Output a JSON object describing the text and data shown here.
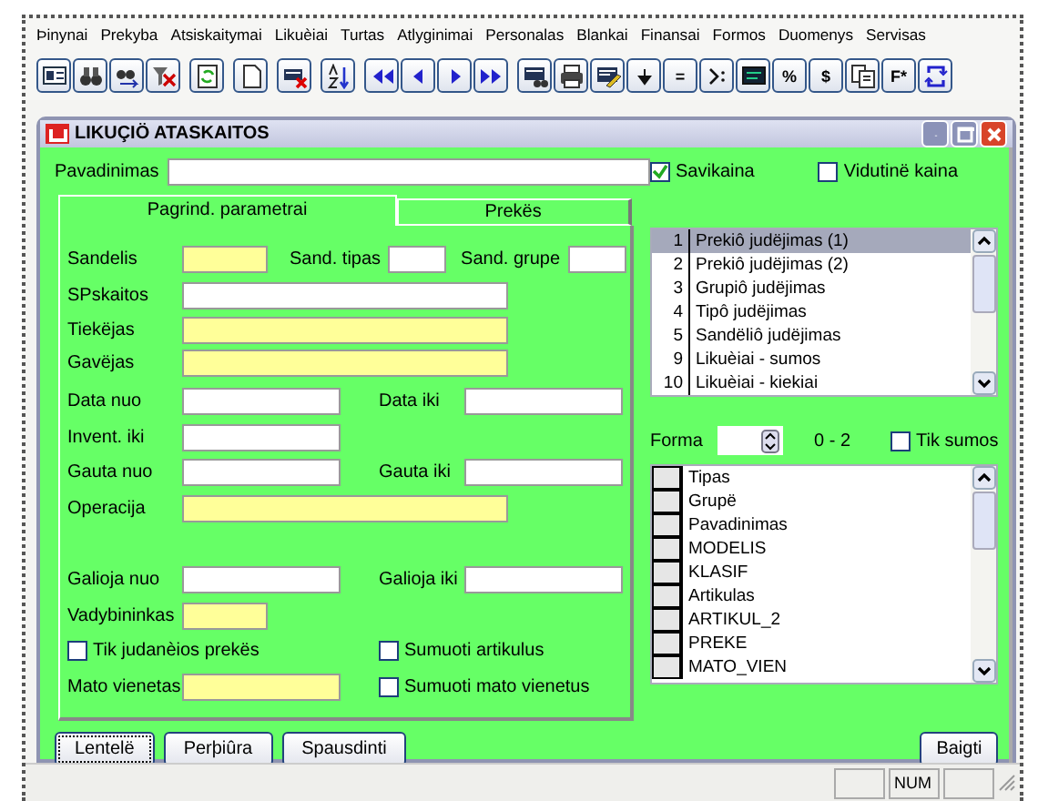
{
  "menu": [
    "Þinynai",
    "Prekyba",
    "Atsiskaitymai",
    "Likuèiai",
    "Turtas",
    "Atlyginimai",
    "Personalas",
    "Blankai",
    "Finansai",
    "Formos",
    "Duomenys",
    "Servisas"
  ],
  "toolbar": [
    [
      {
        "kind": "icon"
      },
      {
        "kind": "icon"
      },
      {
        "kind": "icon"
      },
      {
        "kind": "icon"
      }
    ],
    [
      {
        "kind": "icon"
      }
    ],
    [
      {
        "kind": "icon"
      }
    ],
    [
      {
        "kind": "icon"
      }
    ],
    [
      {
        "kind": "icon"
      }
    ],
    [
      {
        "kind": "icon"
      },
      {
        "kind": "icon"
      },
      {
        "kind": "icon"
      },
      {
        "kind": "icon"
      }
    ],
    [
      {
        "kind": "icon"
      },
      {
        "kind": "icon"
      },
      {
        "kind": "icon"
      },
      {
        "kind": "icon"
      },
      {
        "kind": "text",
        "label": "="
      },
      {
        "kind": "icon"
      },
      {
        "kind": "icon"
      },
      {
        "kind": "text",
        "label": "%"
      },
      {
        "kind": "text",
        "label": "$"
      },
      {
        "kind": "icon"
      },
      {
        "kind": "text",
        "label": "F*"
      },
      {
        "kind": "icon"
      }
    ]
  ],
  "window": {
    "title": "LIKUÇIÖ ATASKAITOS"
  },
  "name_field": {
    "label": "Pavadinimas"
  },
  "tabs": [
    {
      "label": "Pagrind. parametrai",
      "selected": true
    },
    {
      "label": "Prekës",
      "selected": false
    }
  ],
  "rows": [
    {
      "left": [
        {
          "kind": "label",
          "text": "Sandelis"
        },
        {
          "kind": "field-short",
          "highlighted": true
        },
        {
          "kind": "label",
          "text": "Sand. tipas"
        },
        {
          "kind": "field-tiny",
          "highlighted": false
        },
        {
          "kind": "label",
          "text": "Sand. grupe"
        },
        {
          "kind": "field-tiny",
          "highlighted": false
        }
      ]
    },
    {
      "left": [
        {
          "kind": "label",
          "text": "SPskaitos"
        },
        {
          "kind": "field-wide",
          "highlighted": false
        }
      ]
    },
    {
      "left": [
        {
          "kind": "label",
          "text": "Tiekëjas"
        },
        {
          "kind": "field-wide",
          "highlighted": true
        }
      ]
    },
    {
      "left": [
        {
          "kind": "label",
          "text": "Gavëjas"
        },
        {
          "kind": "field-wide",
          "highlighted": true
        }
      ]
    },
    {
      "left": [
        {
          "kind": "label",
          "text": "Data nuo"
        },
        {
          "kind": "field-medium",
          "highlighted": false
        }
      ],
      "right": [
        {
          "kind": "label",
          "text": "Data iki"
        },
        {
          "kind": "field-medium",
          "highlighted": false
        }
      ]
    },
    {
      "left": [
        {
          "kind": "label",
          "text": "Invent. iki"
        },
        {
          "kind": "field-medium",
          "highlighted": false
        }
      ]
    },
    {
      "left": [
        {
          "kind": "label",
          "text": "Gauta nuo"
        },
        {
          "kind": "field-medium",
          "highlighted": false
        }
      ],
      "right": [
        {
          "kind": "label",
          "text": "Gauta iki"
        },
        {
          "kind": "field-medium",
          "highlighted": false
        }
      ]
    },
    {
      "left": [
        {
          "kind": "label",
          "text": "Operacija"
        },
        {
          "kind": "field-long",
          "highlighted": true
        }
      ]
    },
    {
      "left": [
        {
          "kind": "label",
          "text": "Galioja nuo"
        },
        {
          "kind": "field-medium",
          "highlighted": false
        }
      ],
      "right": [
        {
          "kind": "label",
          "text": "Galioja iki"
        },
        {
          "kind": "field-medium",
          "highlighted": false
        }
      ]
    },
    {
      "left": [
        {
          "kind": "label",
          "text": "Vadybininkas"
        },
        {
          "kind": "field-short",
          "highlighted": true
        }
      ]
    },
    {
      "left": [
        {
          "kind": "checkbox",
          "label": "Tik judanèios prekës",
          "checked": false
        }
      ],
      "right": [
        {
          "kind": "checkbox",
          "label": "Sumuoti artikulus",
          "checked": false
        }
      ]
    },
    {
      "left": [
        {
          "kind": "label",
          "text": "Mato vienetas"
        },
        {
          "kind": "field-medium",
          "highlighted": true
        }
      ],
      "right": [
        {
          "kind": "checkbox",
          "label": "Sumuoti mato vienetus",
          "checked": false
        }
      ]
    }
  ],
  "price_options": [
    {
      "label": "Savikaina",
      "checked": true
    },
    {
      "label": "Vidutinë kaina",
      "checked": false
    }
  ],
  "reports": [
    {
      "number": "1",
      "name": "Prekiô judëjimas (1)",
      "selected": true
    },
    {
      "number": "2",
      "name": "Prekiô judëjimas (2)",
      "selected": false
    },
    {
      "number": "3",
      "name": "Grupiô judëjimas",
      "selected": false
    },
    {
      "number": "4",
      "name": "Tipô judëjimas",
      "selected": false
    },
    {
      "number": "5",
      "name": "Sandëliô judëjimas",
      "selected": false
    },
    {
      "number": "9",
      "name": "Likuèiai - sumos",
      "selected": false
    },
    {
      "number": "10",
      "name": "Likuèiai - kiekiai",
      "selected": false
    }
  ],
  "form": {
    "label": "Forma",
    "range": "0 - 2",
    "sums_only": {
      "label": "Tik sumos",
      "checked": false
    }
  },
  "columns": [
    "Tipas",
    "Grupë",
    "Pavadinimas",
    "MODELIS",
    "KLASIF",
    "Artikulas",
    "ARTIKUL_2",
    "PREKE",
    "MATO_VIEN"
  ],
  "buttons": [
    {
      "label": "Lentelë",
      "focused": true
    },
    {
      "label": "Perþiûra",
      "focused": false
    },
    {
      "label": "Spausdinti",
      "focused": false
    }
  ],
  "close_button": "Baigti",
  "status_bar": [
    {
      "kind": "empty"
    },
    {
      "kind": "text",
      "text": "NUM"
    },
    {
      "kind": "empty"
    }
  ]
}
